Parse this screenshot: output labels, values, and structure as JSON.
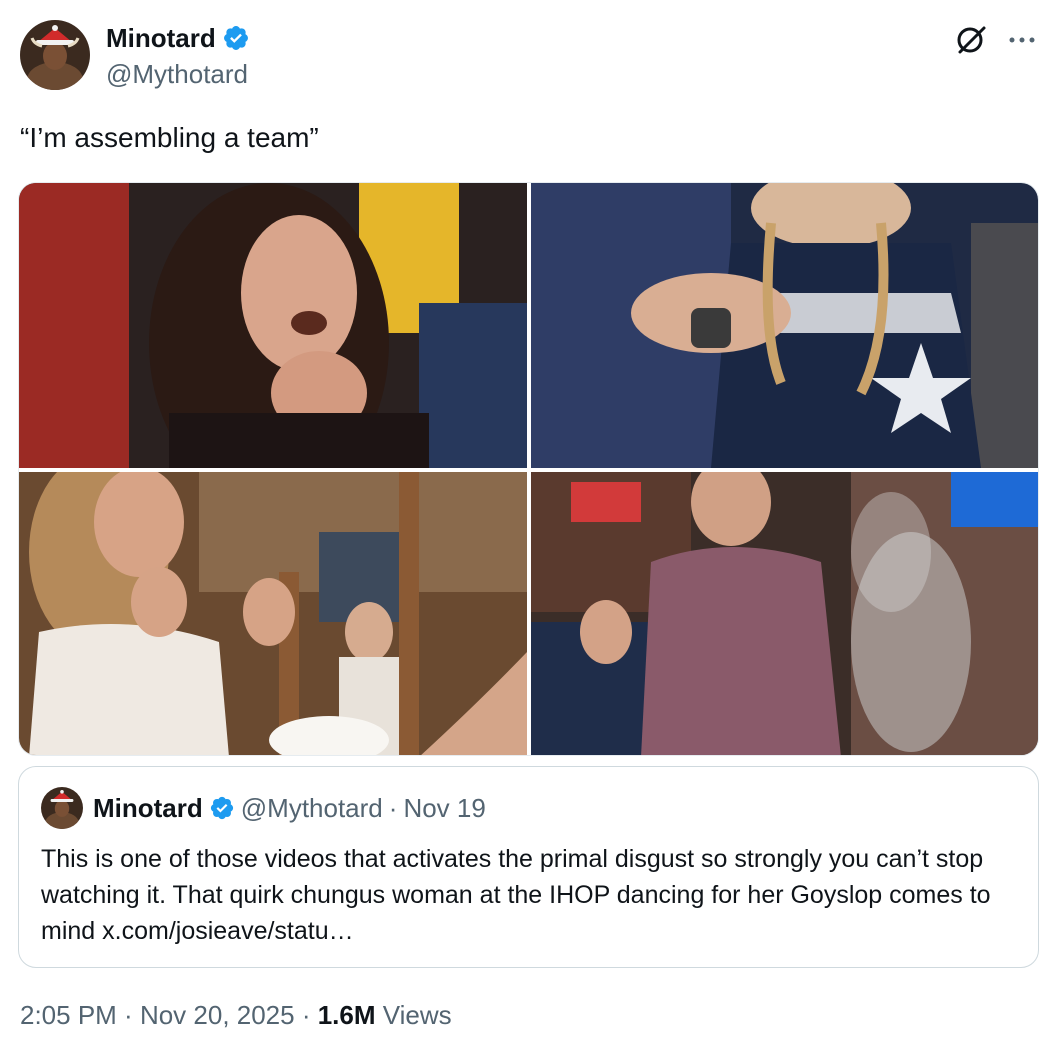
{
  "author": {
    "display_name": "Minotard",
    "handle": "@Mythotard",
    "verified": true,
    "avatar_icon": "minotaur-santa-hat-avatar"
  },
  "actions": {
    "grok_icon": "grok-icon",
    "more_icon": "more-dots-icon"
  },
  "tweet": {
    "text": "“I’m assembling a team”"
  },
  "media": [
    {
      "label": "woman-eating-surprised-photo"
    },
    {
      "label": "woman-in-cowboys-jersey-photo"
    },
    {
      "label": "woman-thumbs-up-diner-photo"
    },
    {
      "label": "man-dancing-smoke-restaurant-photo"
    }
  ],
  "quoted_tweet": {
    "display_name": "Minotard",
    "handle": "@Mythotard",
    "separator": "·",
    "date": "Nov 19",
    "text": "This is one of those videos that activates the primal disgust so strongly you can’t stop watching it. That quirk chungus woman at the IHOP dancing for her Goyslop comes to mind ",
    "link": "x.com/josieave/statu…"
  },
  "footer": {
    "time": "2:05 PM",
    "sep1": " · ",
    "date": "Nov 20, 2025",
    "sep2": " · ",
    "views_count": "1.6M",
    "views_label": " Views"
  },
  "colors": {
    "verified_blue": "#1d9bf0",
    "secondary_text": "#536471",
    "primary_text": "#0f1419",
    "border": "#cfd9de"
  }
}
